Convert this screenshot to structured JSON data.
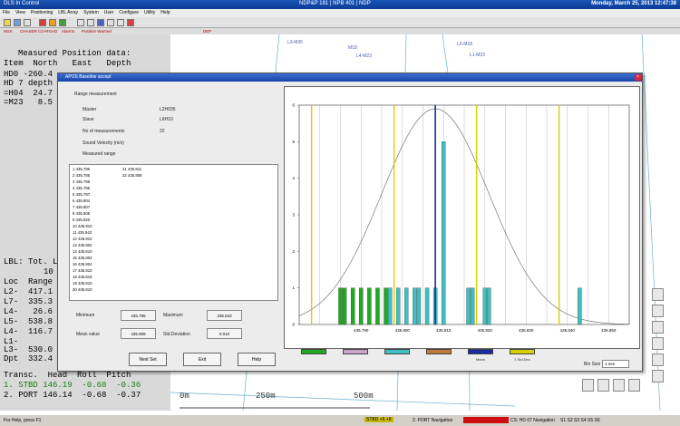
{
  "window": {
    "app_title": "DLS In Control",
    "center_title": "NDP&P 181 | NPB 401 | NDP",
    "datetime": "Monday, March 25, 2013 12:47:38"
  },
  "menu": [
    "File",
    "View",
    "Positioning",
    "LBL Array",
    "System",
    "User",
    "Configure",
    "Utility",
    "Help"
  ],
  "statusstrip": [
    "NDS",
    "CHASER CO-ROAD",
    "Alarms",
    "Position Warned",
    "DEP"
  ],
  "left_panel": {
    "measured_title": "Measured Position data:",
    "measured_headers": "Item  North   East   Depth",
    "measured_rows": [
      "HD0 -260.4",
      "HD 7 depth",
      "=H04  24.7",
      "=M23   8.5"
    ],
    "lbl_title": "LBL: Tot. L",
    "lbl_count": "10",
    "lbl_headers": "Loc  Range",
    "lbl_rows": [
      "L2-  417.1",
      "L7-  335.3",
      "L4-   26.6",
      "L5-  538.8",
      "L4-  116.7",
      "L1-",
      "L3-  530.0",
      "Dpt  332.4"
    ],
    "transc_title": "Transc.  Head  Roll  Pitch",
    "transc_rows": [
      "1. STBD 146.19  -0.68  -0.36",
      "2. PORT 146.14  -0.68  -0.37"
    ]
  },
  "map": {
    "labels": [
      "L3-M35",
      "M18",
      "L4-M23",
      "L5-M18",
      "L1-M23"
    ],
    "scale": [
      "0m",
      "250m",
      "500m"
    ]
  },
  "dialog": {
    "title": "APOS Baseline accept",
    "section": "Range measurement",
    "fields": [
      {
        "label": "Master",
        "value": "L2H035"
      },
      {
        "label": "Slave",
        "value": "L6H10"
      },
      {
        "label": "No of measurements",
        "value": "22"
      },
      {
        "label": "Sound Velocity (m/s)",
        "value": ""
      },
      {
        "label": "Measured range",
        "value": ""
      }
    ],
    "list_col1": [
      "1 435.780",
      "2 435.785",
      "3 435.798",
      "4 435.796",
      "5 435.797",
      "6 435.804",
      "7 435.807",
      "8 435.805",
      "9 435.820",
      "10 435.810",
      "11 435.843",
      "12 435.810",
      "13 435.802",
      "14 435.810",
      "15 435.803",
      "16 435.804",
      "17 435.810",
      "18 435.816",
      "19 435.810",
      "20 435.810"
    ],
    "list_col2": [
      "21 435.811",
      "22 435.808"
    ],
    "stats": [
      {
        "label": "Minimum",
        "value": "435.785"
      },
      {
        "label": "Maximum",
        "value": "435.843"
      },
      {
        "label": "Mean value",
        "value": "435.808"
      },
      {
        "label": "Std.Deviation",
        "value": "0.010"
      }
    ],
    "buttons": [
      "Next Set",
      "Exit",
      "Help"
    ],
    "legend": [
      {
        "label": "",
        "color": "#22a822"
      },
      {
        "label": "",
        "color": "#c9a6c9"
      },
      {
        "label": "",
        "color": "#3fbfbf"
      },
      {
        "label": "",
        "color": "#c07a3a"
      },
      {
        "label": "Mean",
        "color": "#1a2aa0"
      },
      {
        "label": "1 Std.Dev",
        "color": "#d6d000"
      }
    ],
    "bin_size_label": "Bin Size",
    "bin_size_value": "1 mm"
  },
  "chart_data": {
    "type": "bar",
    "x_ticks": [
      "435.790",
      "435.800",
      "435.810",
      "435.820",
      "435.830",
      "435.840",
      "435.850"
    ],
    "ylim": [
      0,
      6
    ],
    "y_ticks": [
      "0",
      "1",
      "2",
      "3",
      "4",
      "5",
      "6"
    ],
    "bins": [
      {
        "x": 435.785,
        "count": 1,
        "color": "#22a822"
      },
      {
        "x": 435.786,
        "count": 1,
        "color": "#22a822"
      },
      {
        "x": 435.788,
        "count": 1,
        "color": "#22a822"
      },
      {
        "x": 435.79,
        "count": 1,
        "color": "#22a822"
      },
      {
        "x": 435.792,
        "count": 1,
        "color": "#22a822"
      },
      {
        "x": 435.794,
        "count": 1,
        "color": "#22a822"
      },
      {
        "x": 435.796,
        "count": 1,
        "color": "#22a822"
      },
      {
        "x": 435.797,
        "count": 1,
        "color": "#3fbfbf"
      },
      {
        "x": 435.799,
        "count": 1,
        "color": "#3fbfbf"
      },
      {
        "x": 435.801,
        "count": 1,
        "color": "#3fbfbf"
      },
      {
        "x": 435.803,
        "count": 1,
        "color": "#3fbfbf"
      },
      {
        "x": 435.804,
        "count": 1,
        "color": "#3fbfbf"
      },
      {
        "x": 435.806,
        "count": 1,
        "color": "#3fbfbf"
      },
      {
        "x": 435.808,
        "count": 1,
        "color": "#3fbfbf"
      },
      {
        "x": 435.81,
        "count": 5,
        "color": "#3fbfbf"
      },
      {
        "x": 435.816,
        "count": 1,
        "color": "#3fbfbf"
      },
      {
        "x": 435.817,
        "count": 1,
        "color": "#3fbfbf"
      },
      {
        "x": 435.82,
        "count": 1,
        "color": "#3fbfbf"
      },
      {
        "x": 435.821,
        "count": 1,
        "color": "#3fbfbf"
      },
      {
        "x": 435.843,
        "count": 1,
        "color": "#3fbfbf"
      }
    ],
    "mean": 435.808,
    "std_lines": [
      435.778,
      435.798,
      435.818,
      435.838
    ]
  },
  "statusbar": {
    "help": "For Help, press F1",
    "items": [
      "STBD  +5 +8",
      "2. PORT Navigation",
      "CS: HD 07 Navigation",
      "S1 S2 S3 S4 S5 S6"
    ]
  }
}
